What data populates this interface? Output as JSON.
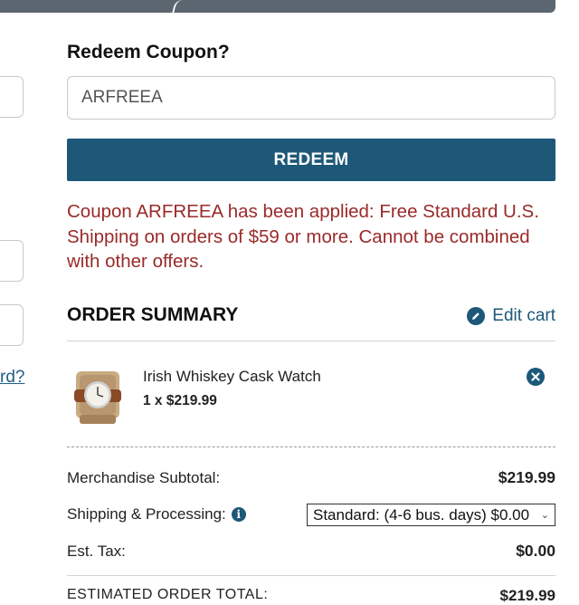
{
  "coupon": {
    "heading": "Redeem Coupon?",
    "input_value": "ARFREEA",
    "redeem_label": "REDEEM",
    "message": "Coupon ARFREEA has been applied: Free Standard U.S. Shipping on orders of $59 or more. Cannot be combined with other offers."
  },
  "left_panel": {
    "link_text": "rd?"
  },
  "summary": {
    "title": "ORDER SUMMARY",
    "edit_cart_label": "Edit cart"
  },
  "cart_item": {
    "name": "Irish Whiskey Cask Watch",
    "quantity_price": "1 x $219.99",
    "image_icon": "watch-product-image"
  },
  "totals": {
    "subtotal_label": "Merchandise Subtotal:",
    "subtotal_value": "$219.99",
    "shipping_label": "Shipping & Processing:",
    "shipping_selected": "Standard: (4-6 bus. days) $0.00",
    "tax_label": "Est. Tax:",
    "tax_value": "$0.00",
    "total_label": "ESTIMATED ORDER TOTAL:",
    "total_value": "$219.99"
  },
  "colors": {
    "accent": "#1d5878",
    "message": "#9a2a2a",
    "top_bar": "#5c6670"
  }
}
